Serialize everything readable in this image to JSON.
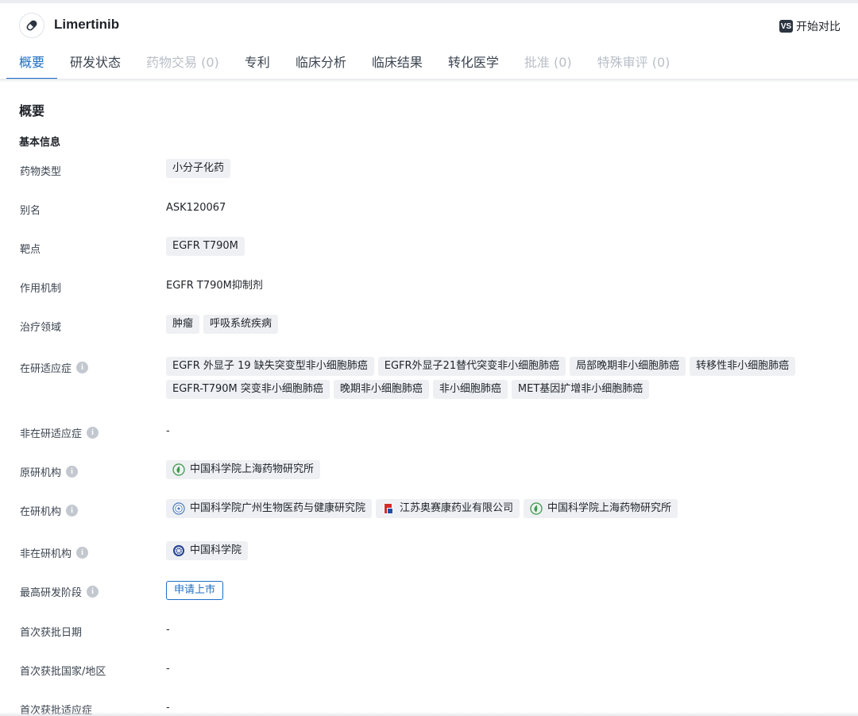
{
  "header": {
    "drug_name": "Limertinib",
    "compare_badge": "VS",
    "compare_label": "开始对比"
  },
  "tabs": [
    {
      "label": "概要",
      "state": "active"
    },
    {
      "label": "研发状态",
      "state": "normal"
    },
    {
      "label": "药物交易 (0)",
      "state": "disabled"
    },
    {
      "label": "专利",
      "state": "normal"
    },
    {
      "label": "临床分析",
      "state": "normal"
    },
    {
      "label": "临床结果",
      "state": "normal"
    },
    {
      "label": "转化医学",
      "state": "normal"
    },
    {
      "label": "批准 (0)",
      "state": "disabled"
    },
    {
      "label": "特殊审评 (0)",
      "state": "disabled"
    }
  ],
  "section": {
    "title": "概要",
    "subtitle": "基本信息"
  },
  "fields": {
    "drug_type": {
      "label": "药物类型",
      "tags": [
        "小分子化药"
      ]
    },
    "alias": {
      "label": "别名",
      "text": "ASK120067"
    },
    "target": {
      "label": "靶点",
      "tags": [
        "EGFR T790M"
      ]
    },
    "mechanism": {
      "label": "作用机制",
      "text": "EGFR T790M抑制剂"
    },
    "therapeutic_area": {
      "label": "治疗领域",
      "tags": [
        "肿瘤",
        "呼吸系统疾病"
      ]
    },
    "active_indications": {
      "label": "在研适应症",
      "tags": [
        "EGFR 外显子 19 缺失突变型非小细胞肺癌",
        "EGFR外显子21替代突变非小细胞肺癌",
        "局部晚期非小细胞肺癌",
        "转移性非小细胞肺癌",
        "EGFR-T790M 突变非小细胞肺癌",
        "晚期非小细胞肺癌",
        "非小细胞肺癌",
        "MET基因扩增非小细胞肺癌"
      ]
    },
    "inactive_indications": {
      "label": "非在研适应症",
      "text": "-"
    },
    "originator": {
      "label": "原研机构",
      "orgs": [
        {
          "name": "中国科学院上海药物研究所",
          "icon": "leaf-logo-icon"
        }
      ]
    },
    "active_orgs": {
      "label": "在研机构",
      "orgs": [
        {
          "name": "中国科学院广州生物医药与健康研究院",
          "icon": "circle-seal-logo-icon"
        },
        {
          "name": "江苏奥赛康药业有限公司",
          "icon": "aosaikang-logo-icon"
        },
        {
          "name": "中国科学院上海药物研究所",
          "icon": "leaf-logo-icon"
        }
      ]
    },
    "inactive_orgs": {
      "label": "非在研机构",
      "orgs": [
        {
          "name": "中国科学院",
          "icon": "cas-logo-icon"
        }
      ]
    },
    "highest_phase": {
      "label": "最高研发阶段",
      "stage": "申请上市"
    },
    "first_approval_date": {
      "label": "首次获批日期",
      "text": "-"
    },
    "first_approval_region": {
      "label": "首次获批国家/地区",
      "text": "-"
    },
    "first_approval_indication": {
      "label": "首次获批适应症",
      "text": "-"
    }
  },
  "colors": {
    "accent": "#1f6fc5",
    "tag_bg": "#eef0f3",
    "disabled_tab": "#b9bfc7"
  }
}
